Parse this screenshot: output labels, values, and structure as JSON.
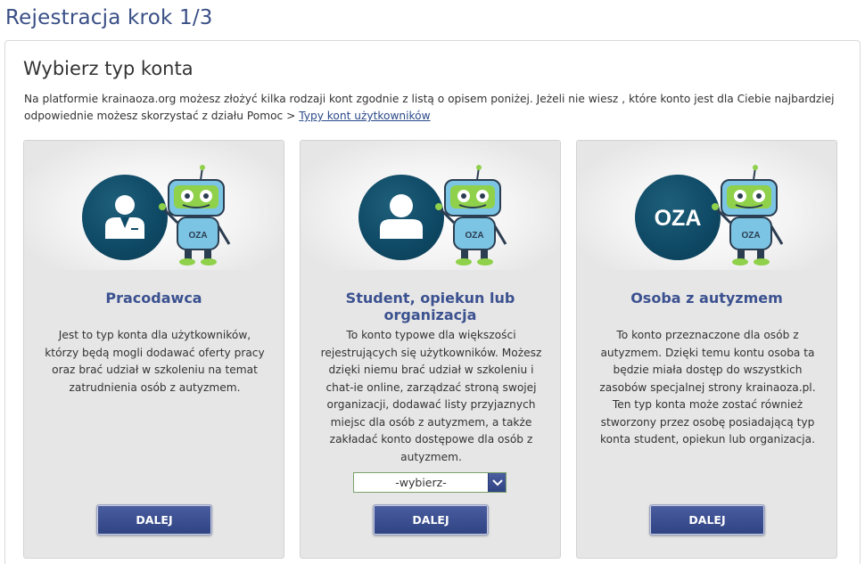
{
  "page": {
    "title": "Rejestracja krok 1/3"
  },
  "section": {
    "title": "Wybierz typ konta",
    "intro_text": "Na platformie krainaoza.org możesz złożyć kilka rodzaji kont zgodnie z listą o opisem poniżej. Jeżeli nie wiesz , które konto jest dla Ciebie najbardziej odpowiednie możesz skorzystać z działu Pomoc > ",
    "intro_link": "Typy kont użytkowników"
  },
  "cards": [
    {
      "title": "Pracodawca",
      "description": "Jest to typ konta dla użytkowników, którzy będą mogli dodawać oferty pracy oraz brać udział w szkoleniu na temat zatrudnienia osób z autyzmem.",
      "button": "DALEJ",
      "icon": "employer-icon"
    },
    {
      "title": "Student, opiekun lub organizacja",
      "description": "To konto typowe dla większości rejestrujących się użytkowników. Możesz dzięki niemu brać udział w szkoleniu i chat-ie online, zarządzać stroną swojej organizacji, dodawać listy przyjaznych miejsc dla osób z autyzmem, a także zakładać konto dostępowe dla osób z autyzmem.",
      "select": {
        "value": "-wybierz-"
      },
      "button": "DALEJ",
      "icon": "user-icon"
    },
    {
      "title": "Osoba z autyzmem",
      "description": "To konto przeznaczone dla osób z autyzmem. Dzięki temu kontu osoba ta będzie miała dostęp do wszystkich zasobów specjalnej strony krainaoza.pl. Ten typ konta może zostać również stworzony przez osobę posiadającą typ konta student, opiekun lub organizacja.",
      "button": "DALEJ",
      "circle_text": "OZA"
    }
  ],
  "robot": {
    "badge": "OZA"
  },
  "colors": {
    "title_blue": "#3a4f86",
    "button": "#33468a",
    "circle": "#0f4a66",
    "robot_green": "#8fd14a"
  }
}
